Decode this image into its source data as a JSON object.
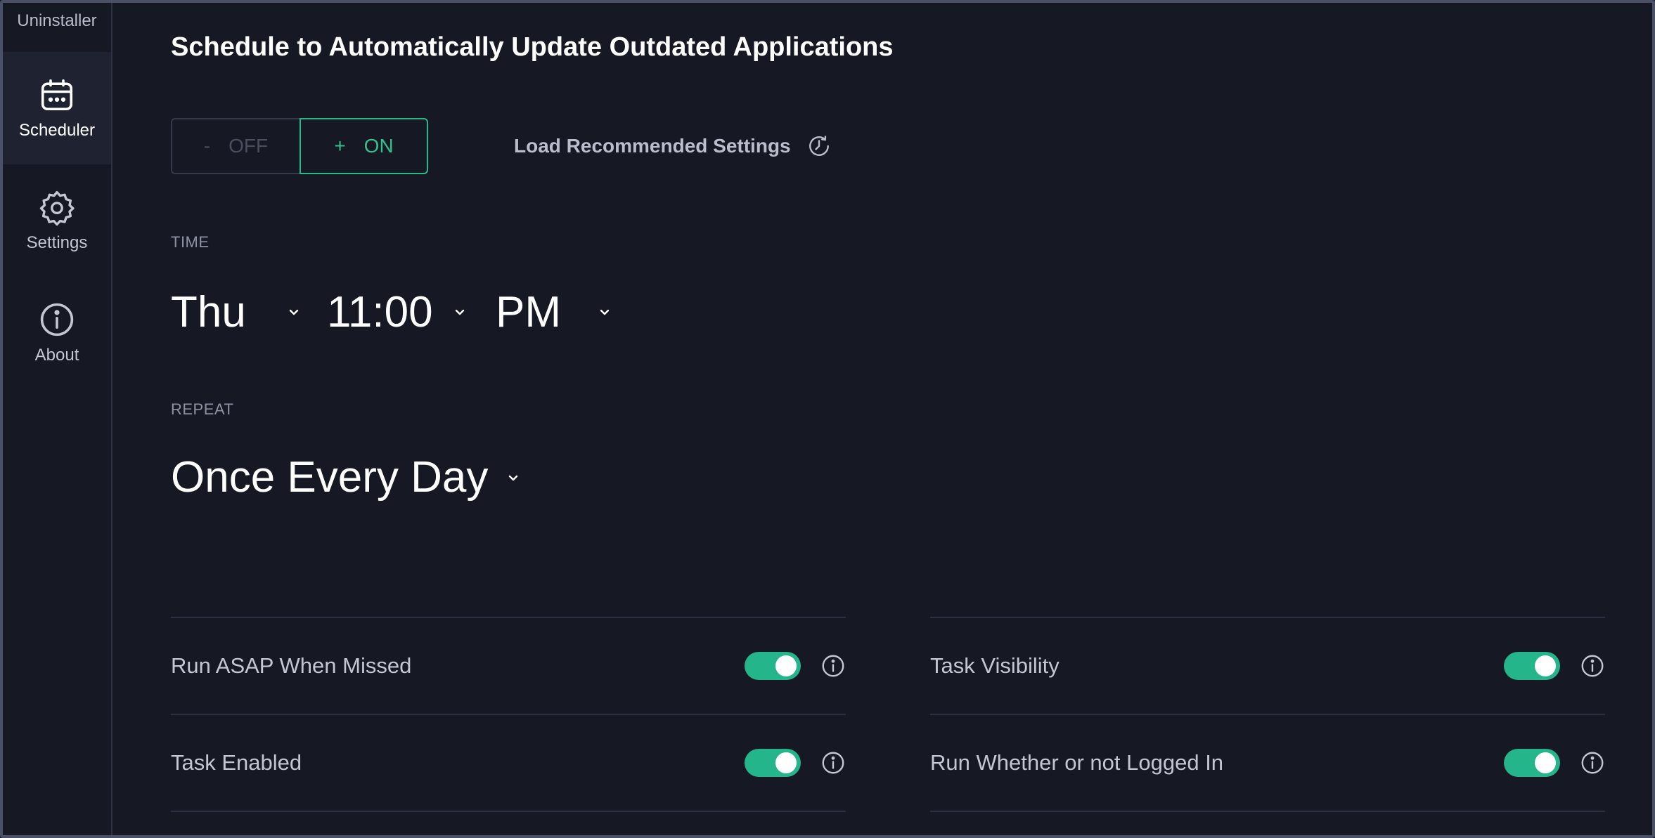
{
  "sidebar": {
    "app_name": "Uninstaller",
    "items": [
      {
        "label": "Scheduler",
        "icon": "calendar-icon",
        "active": true
      },
      {
        "label": "Settings",
        "icon": "gear-icon",
        "active": false
      },
      {
        "label": "About",
        "icon": "info-icon",
        "active": false
      }
    ]
  },
  "header": {
    "title": "Schedule to Automatically Update Outdated Applications"
  },
  "power_toggle": {
    "off_symbol": "-",
    "off_label": "OFF",
    "on_symbol": "+",
    "on_label": "ON",
    "selected": "ON"
  },
  "recommended": {
    "label": "Load Recommended Settings",
    "icon": "clock-icon"
  },
  "time": {
    "section_label": "TIME",
    "day": "Thu",
    "clock": "11:00",
    "meridiem": "PM"
  },
  "repeat": {
    "section_label": "REPEAT",
    "value": "Once Every Day"
  },
  "options": [
    {
      "label": "Run ASAP When Missed",
      "enabled": true
    },
    {
      "label": "Task Enabled",
      "enabled": true
    },
    {
      "label": "Task Visibility",
      "enabled": true
    },
    {
      "label": "Run Whether or not Logged In",
      "enabled": true
    }
  ],
  "colors": {
    "accent": "#2bb889",
    "background": "#161823",
    "border": "#4a5066"
  }
}
